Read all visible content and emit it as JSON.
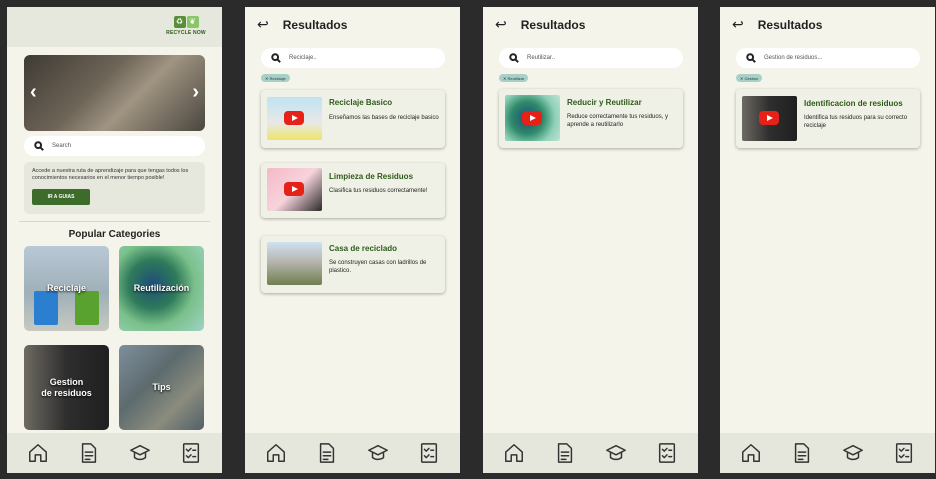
{
  "home": {
    "logo_text": "RECYCLE NOW",
    "search_placeholder": "Search",
    "info_text": "Accede a nuestra ruta de aprendizaje para que tengas todos los conocimientos necesarios en el menor tiempo posible!",
    "cta_label": "IR A GUIAS",
    "popular_title": "Popular Categories",
    "categories": [
      {
        "label": "Reciclaje"
      },
      {
        "label": "Reutilización"
      },
      {
        "label": "Gestion\nde residuos"
      },
      {
        "label": "Tips"
      }
    ]
  },
  "results_title": "Resultados",
  "screens": [
    {
      "search_placeholder": "Reciclaje..",
      "chip": "Reciclaje",
      "cards": [
        {
          "title": "Reciclaje Basico",
          "desc": "Enseñamos las bases de reciclaje basico"
        },
        {
          "title": "Limpieza de Residuos",
          "desc": "Clasifica tus residuos correctamente!"
        },
        {
          "title": "Casa de reciclado",
          "desc": "Se construyen casas con ladrillos de plastico."
        }
      ]
    },
    {
      "search_placeholder": "Reutilizar..",
      "chip": "Reutilizar",
      "cards": [
        {
          "title": "Reducir y Reutilizar",
          "desc": "Reduce correctamente tus residuos, y aprende a reutilizarlo"
        }
      ]
    },
    {
      "search_placeholder": "Gestion de residuos...",
      "chip": "Gestion",
      "cards": [
        {
          "title": "Identificacion de residuos",
          "desc": "Identifica tus residuos para su correcto reciclaje"
        }
      ]
    }
  ],
  "nav": [
    "home-icon",
    "document-icon",
    "graduation-cap-icon",
    "checklist-icon"
  ]
}
